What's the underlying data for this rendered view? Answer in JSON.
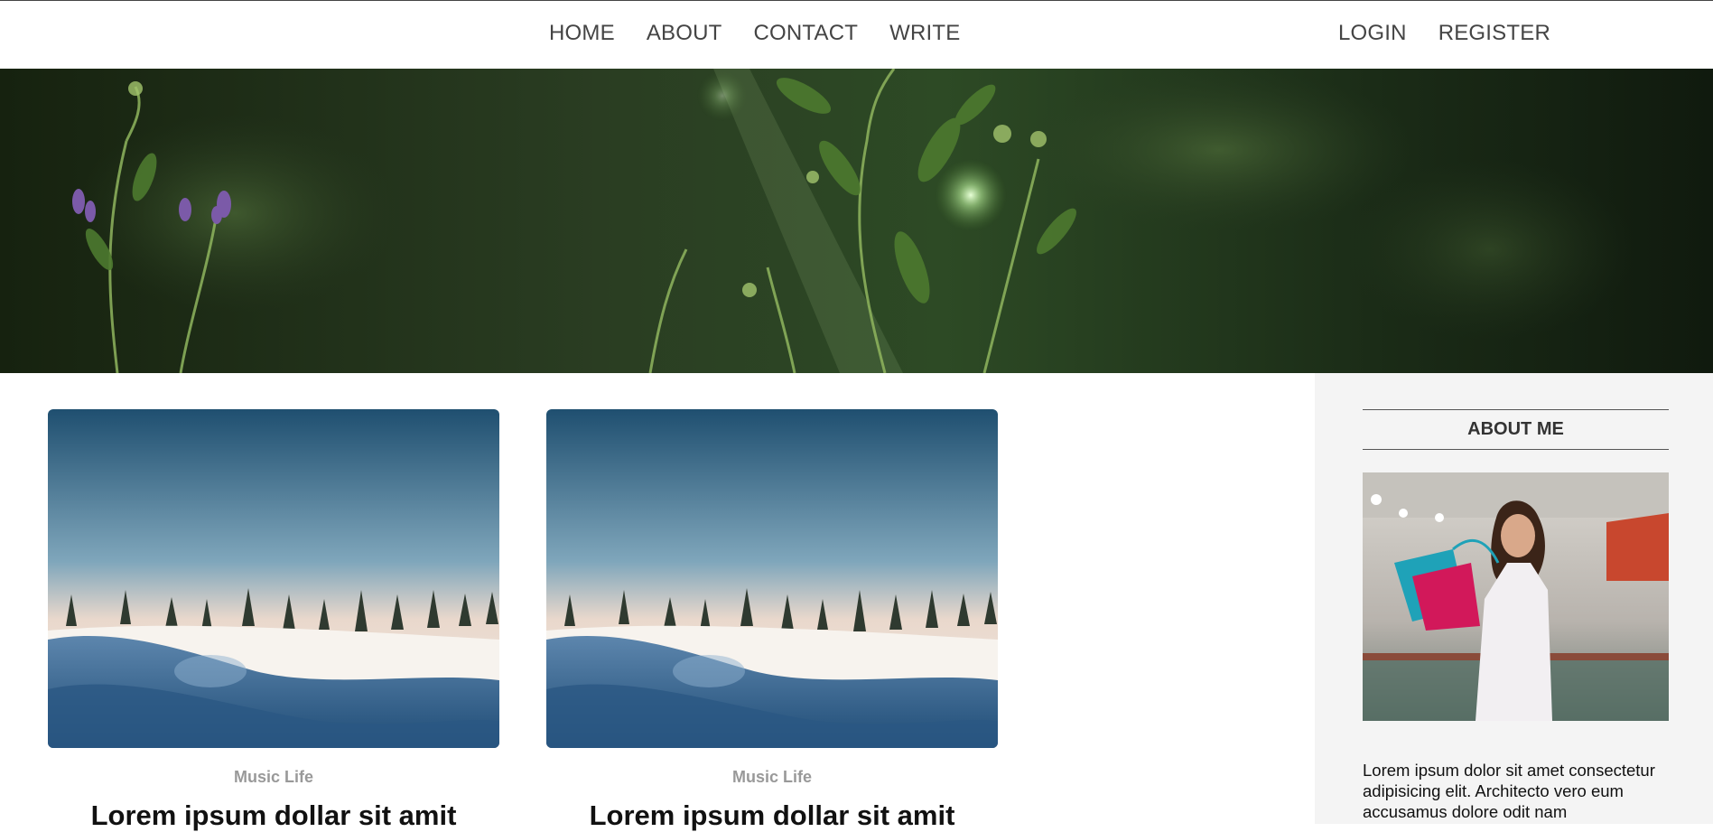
{
  "nav": {
    "links": [
      {
        "label": "HOME"
      },
      {
        "label": "ABOUT"
      },
      {
        "label": "CONTACT"
      },
      {
        "label": "WRITE"
      }
    ],
    "auth": [
      {
        "label": "LOGIN"
      },
      {
        "label": "REGISTER"
      }
    ]
  },
  "posts": [
    {
      "category": "Music Life",
      "title": "Lorem ipsum dollar sit amit"
    },
    {
      "category": "Music Life",
      "title": "Lorem ipsum dollar sit amit"
    }
  ],
  "sidebar": {
    "title": "ABOUT ME",
    "text": "Lorem ipsum dolor sit amet consectetur adipisicing elit. Architecto vero eum accusamus dolore odit nam"
  }
}
